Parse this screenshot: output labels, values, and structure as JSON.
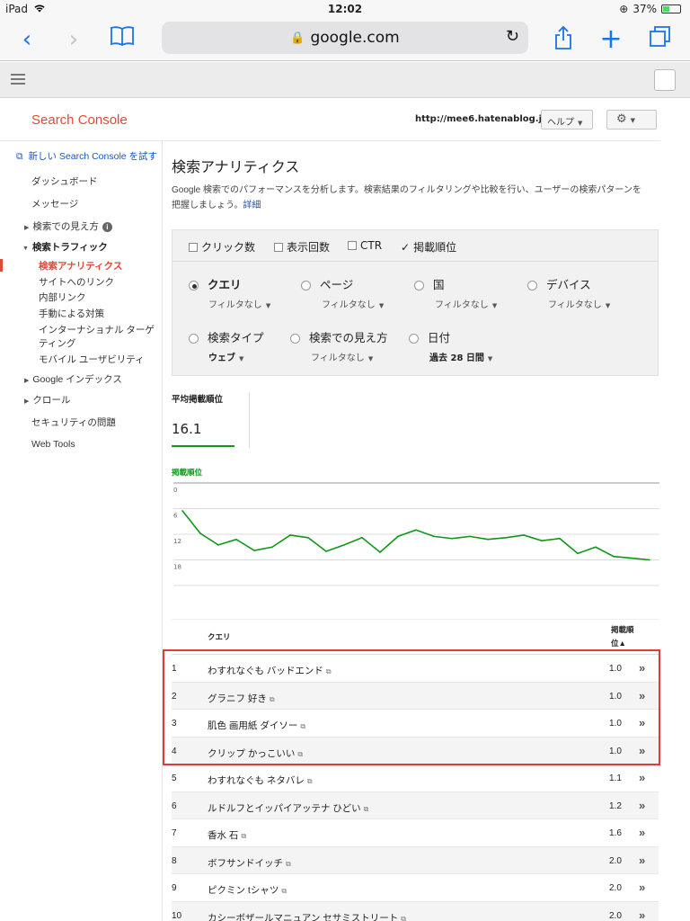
{
  "status_bar": {
    "device": "iPad",
    "time": "12:02",
    "battery": "37%",
    "battery_level": 0.37
  },
  "browser": {
    "url": "google.com"
  },
  "header": {
    "brand": "Search Console",
    "site_url": "http://mee6.hatenablog.jp/",
    "help_label": "ヘルプ"
  },
  "nav": {
    "new_console": "新しい Search Console を試す",
    "items": [
      {
        "label": "ダッシュボード"
      },
      {
        "label": "メッセージ"
      },
      {
        "label": "検索での見え方"
      },
      {
        "label": "検索トラフィック"
      },
      {
        "label": "検索アナリティクス"
      },
      {
        "label": "サイトへのリンク"
      },
      {
        "label": "内部リンク"
      },
      {
        "label": "手動による対策"
      },
      {
        "label": "インターナショナル ターゲ"
      },
      {
        "label": "ティング"
      },
      {
        "label": "モバイル ユーザビリティ"
      },
      {
        "label": "Google インデックス"
      },
      {
        "label": "クロール"
      },
      {
        "label": "セキュリティの問題"
      },
      {
        "label": "Web Tools"
      }
    ]
  },
  "main": {
    "title": "検索アナリティクス",
    "desc_line1": "Google 検索でのパフォーマンスを分析します。検索結果のフィルタリングや比較を行い、ユーザーの検索パターンを",
    "desc_line2": "把握しましょう。",
    "desc_link": "詳細",
    "metrics": [
      {
        "label": "クリック数",
        "checked": false
      },
      {
        "label": "表示回数",
        "checked": false
      },
      {
        "label": "CTR",
        "checked": false
      },
      {
        "label": "掲載順位",
        "checked": true
      }
    ],
    "dimensions": [
      {
        "label": "クエリ",
        "sub": "フィルタなし",
        "selected": true
      },
      {
        "label": "ページ",
        "sub": "フィルタなし",
        "selected": false
      },
      {
        "label": "国",
        "sub": "フィルタなし",
        "selected": false
      },
      {
        "label": "デバイス",
        "sub": "フィルタなし",
        "selected": false
      },
      {
        "label": "検索タイプ",
        "sub": "ウェブ",
        "selected": false
      },
      {
        "label": "検索での見え方",
        "sub": "フィルタなし",
        "selected": false
      },
      {
        "label": "日付",
        "sub": "過去 28 日間",
        "selected": false
      }
    ],
    "summary": {
      "label": "平均掲載順位",
      "value": "16.1"
    }
  },
  "chart_data": {
    "type": "line",
    "title": "掲載順位",
    "y_ticks": [
      "0",
      "6",
      "12",
      "18"
    ],
    "ylim": [
      0,
      24
    ],
    "y_inverted": true,
    "series": [
      {
        "name": "掲載順位",
        "color": "#109618",
        "values": [
          6.5,
          11.8,
          14.5,
          13.2,
          15.8,
          15.0,
          12.2,
          12.8,
          16.0,
          14.5,
          12.8,
          16.2,
          12.5,
          11.0,
          12.5,
          13.0,
          12.5,
          13.2,
          12.8,
          12.2,
          13.5,
          13.0,
          16.5,
          15.0,
          17.2,
          17.6,
          18.0
        ]
      }
    ],
    "grid": true
  },
  "table": {
    "col_query": "クエリ",
    "col_position": "掲載順",
    "col_position_2": "位▲",
    "rows": [
      {
        "n": "1",
        "query": "わすれなぐも バッドエンド",
        "pos": "1.0"
      },
      {
        "n": "2",
        "query": "グラニフ 好き",
        "pos": "1.0"
      },
      {
        "n": "3",
        "query": "肌色 画用紙 ダイソー",
        "pos": "1.0"
      },
      {
        "n": "4",
        "query": "クリップ かっこいい",
        "pos": "1.0"
      },
      {
        "n": "5",
        "query": "わすれなぐも ネタバレ",
        "pos": "1.1"
      },
      {
        "n": "6",
        "query": "ルドルフとイッパイアッテナ ひどい",
        "pos": "1.2"
      },
      {
        "n": "7",
        "query": "香水 石",
        "pos": "1.6"
      },
      {
        "n": "8",
        "query": "ボフサンドイッチ",
        "pos": "2.0"
      },
      {
        "n": "9",
        "query": "ピクミン tシャツ",
        "pos": "2.0"
      },
      {
        "n": "10",
        "query": "カシーボザールマニュアン セサミストリート",
        "pos": "2.0"
      }
    ]
  }
}
